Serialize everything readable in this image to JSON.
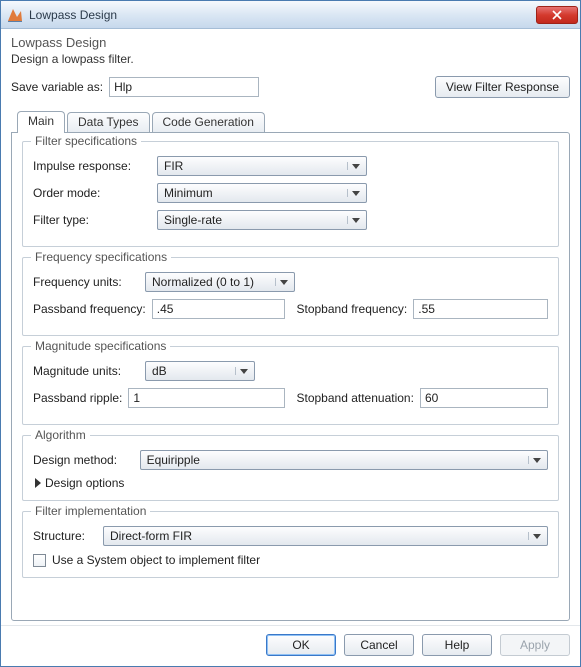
{
  "window": {
    "title": "Lowpass Design"
  },
  "header": {
    "title": "Lowpass Design",
    "desc": "Design a lowpass filter."
  },
  "save": {
    "label": "Save variable as:",
    "value": "Hlp",
    "view_btn": "View Filter Response"
  },
  "tabs": {
    "main": "Main",
    "data_types": "Data Types",
    "code_gen": "Code Generation"
  },
  "filter_spec": {
    "legend": "Filter specifications",
    "impulse_label": "Impulse response:",
    "impulse_value": "FIR",
    "order_label": "Order mode:",
    "order_value": "Minimum",
    "type_label": "Filter type:",
    "type_value": "Single-rate"
  },
  "freq_spec": {
    "legend": "Frequency specifications",
    "units_label": "Frequency units:",
    "units_value": "Normalized (0 to 1)",
    "passband_label": "Passband frequency:",
    "passband_value": ".45",
    "stopband_label": "Stopband frequency:",
    "stopband_value": ".55"
  },
  "mag_spec": {
    "legend": "Magnitude specifications",
    "units_label": "Magnitude units:",
    "units_value": "dB",
    "ripple_label": "Passband ripple:",
    "ripple_value": "1",
    "atten_label": "Stopband attenuation:",
    "atten_value": "60"
  },
  "algorithm": {
    "legend": "Algorithm",
    "method_label": "Design method:",
    "method_value": "Equiripple",
    "options_label": "Design options"
  },
  "impl": {
    "legend": "Filter implementation",
    "structure_label": "Structure:",
    "structure_value": "Direct-form FIR",
    "system_obj_label": "Use a System object to implement filter"
  },
  "buttons": {
    "ok": "OK",
    "cancel": "Cancel",
    "help": "Help",
    "apply": "Apply"
  }
}
